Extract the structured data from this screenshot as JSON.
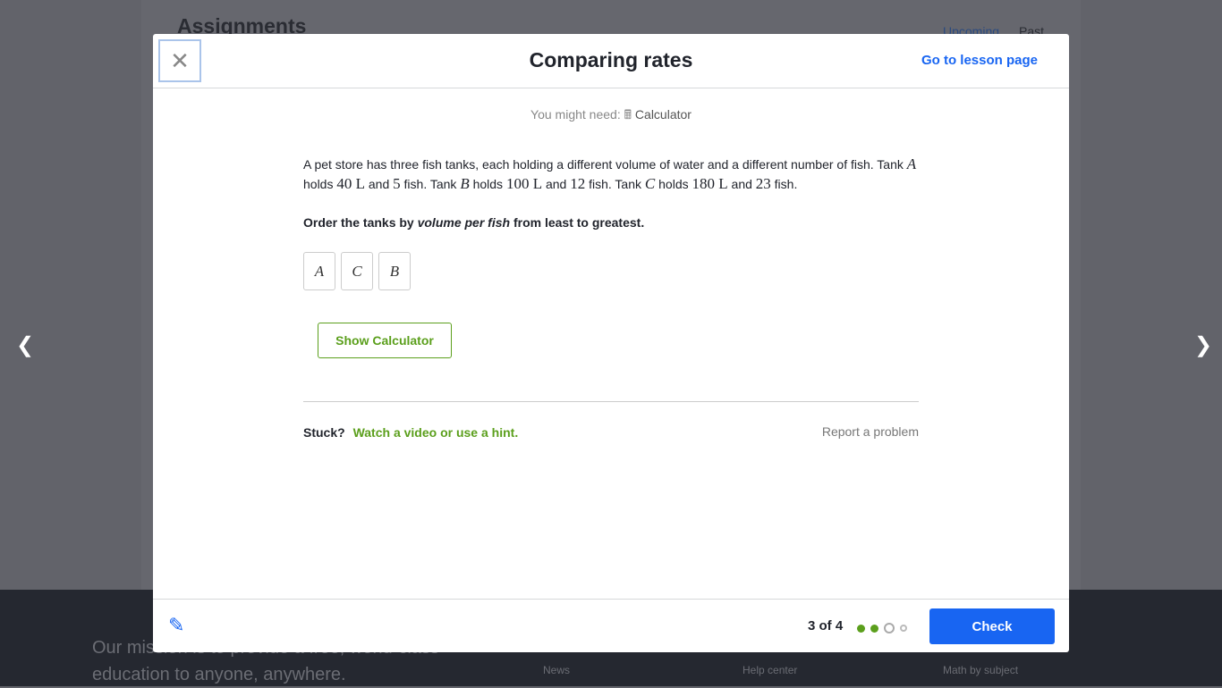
{
  "background": {
    "title": "Assignments",
    "tabs": [
      "Upcoming",
      "Past"
    ],
    "mission": "Our mission is to provide a free, world-class education to anyone, anywhere.",
    "footer_links": [
      "News",
      "Help center",
      "Math by subject"
    ]
  },
  "modal": {
    "title": "Comparing rates",
    "lesson_link": "Go to lesson page",
    "might_need": "You might need:",
    "tool": "Calculator",
    "problem": {
      "p1": "A pet store has three fish tanks, each holding a different volume of water and a different number of fish. Tank ",
      "A": "A",
      "p2": " holds ",
      "v1": "40 L",
      "p3": " and ",
      "f1": "5",
      "p4": " fish. Tank ",
      "B": "B",
      "p5": " holds ",
      "v2": "100 L",
      "p6": " and ",
      "f2": "12",
      "p7": " fish. Tank ",
      "C": "C",
      "p8": " holds ",
      "v3": "180 L",
      "p9": " and ",
      "f3": "23",
      "p10": " fish."
    },
    "question": {
      "pre": "Order the tanks by ",
      "em": "volume per fish",
      "post": " from least to greatest."
    },
    "tiles": [
      "A",
      "C",
      "B"
    ],
    "show_calculator": "Show Calculator",
    "stuck": "Stuck?",
    "hint_link": "Watch a video or use a hint.",
    "report": "Report a problem",
    "progress": {
      "label": "3 of 4",
      "current": 3,
      "total": 4,
      "completed": 2
    },
    "check": "Check"
  },
  "colors": {
    "accent": "#1865f2",
    "success": "#5b9f1c"
  }
}
